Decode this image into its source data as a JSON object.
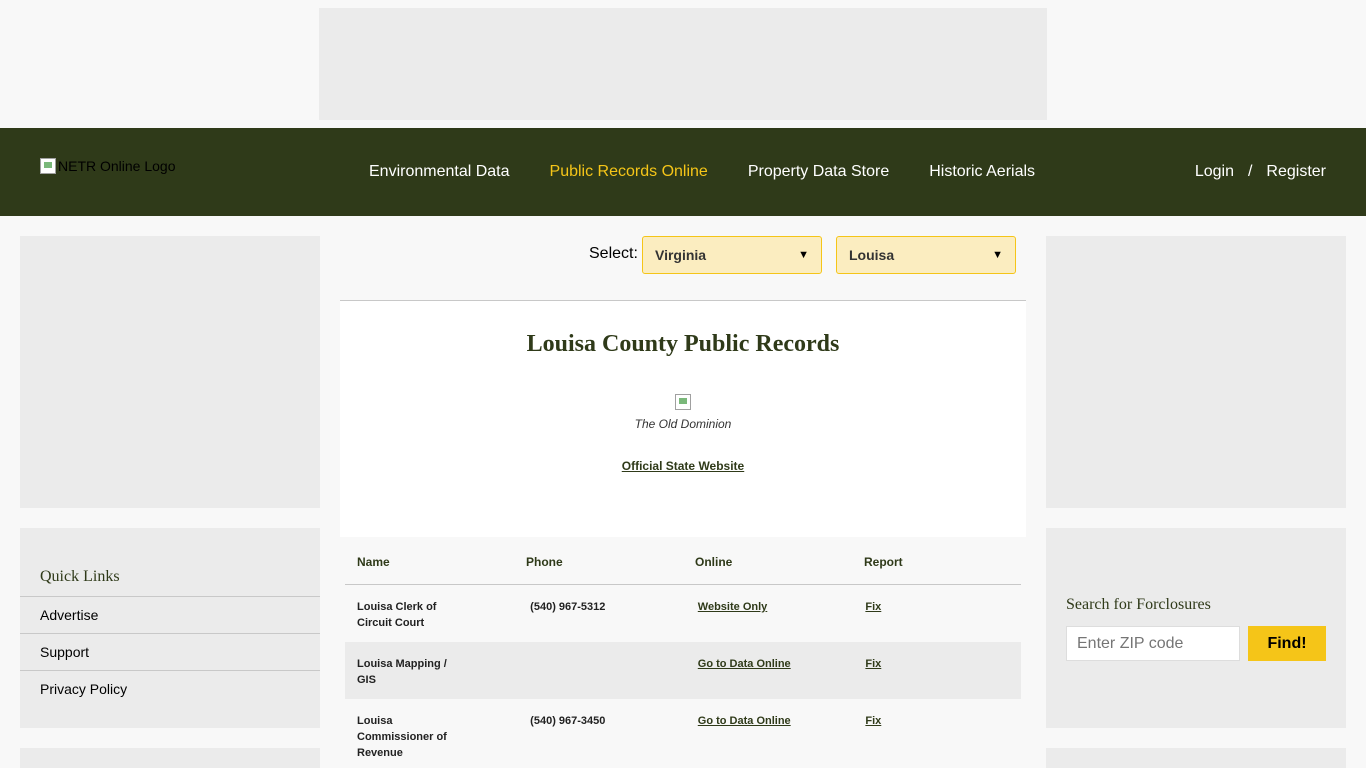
{
  "logo": {
    "alt": "NETR Online Logo"
  },
  "nav": {
    "items": [
      {
        "label": "Environmental Data"
      },
      {
        "label": "Public Records Online"
      },
      {
        "label": "Property Data Store"
      },
      {
        "label": "Historic Aerials"
      }
    ],
    "login": "Login",
    "separator": "/",
    "register": "Register"
  },
  "quick_links": {
    "title": "Quick Links",
    "items": [
      "Advertise",
      "Support",
      "Privacy Policy"
    ]
  },
  "foreclosures": {
    "title": "Search for Forclosures",
    "placeholder": "Enter ZIP code",
    "button": "Find!"
  },
  "select": {
    "label": "Select:",
    "state": "Virginia",
    "county": "Louisa"
  },
  "county": {
    "title": "Louisa County Public Records",
    "motto": "The Old Dominion",
    "state_link": "Official State Website"
  },
  "records": {
    "headers": [
      "Name",
      "Phone",
      "Online",
      "Report"
    ],
    "rows": [
      {
        "name": "Louisa Clerk of Circuit Court",
        "phone": "(540) 967-5312",
        "online": "Website Only",
        "report": "Fix"
      },
      {
        "name": "Louisa Mapping / GIS",
        "phone": "",
        "online": "Go to Data Online",
        "report": "Fix"
      },
      {
        "name": "Louisa Commissioner of Revenue",
        "phone": "(540) 967-3450",
        "online": "Go to Data Online",
        "report": "Fix"
      }
    ]
  },
  "colors": {
    "brand_dark": "#2f3a19",
    "accent": "#f5c518",
    "ad_gray": "#ebebeb"
  }
}
